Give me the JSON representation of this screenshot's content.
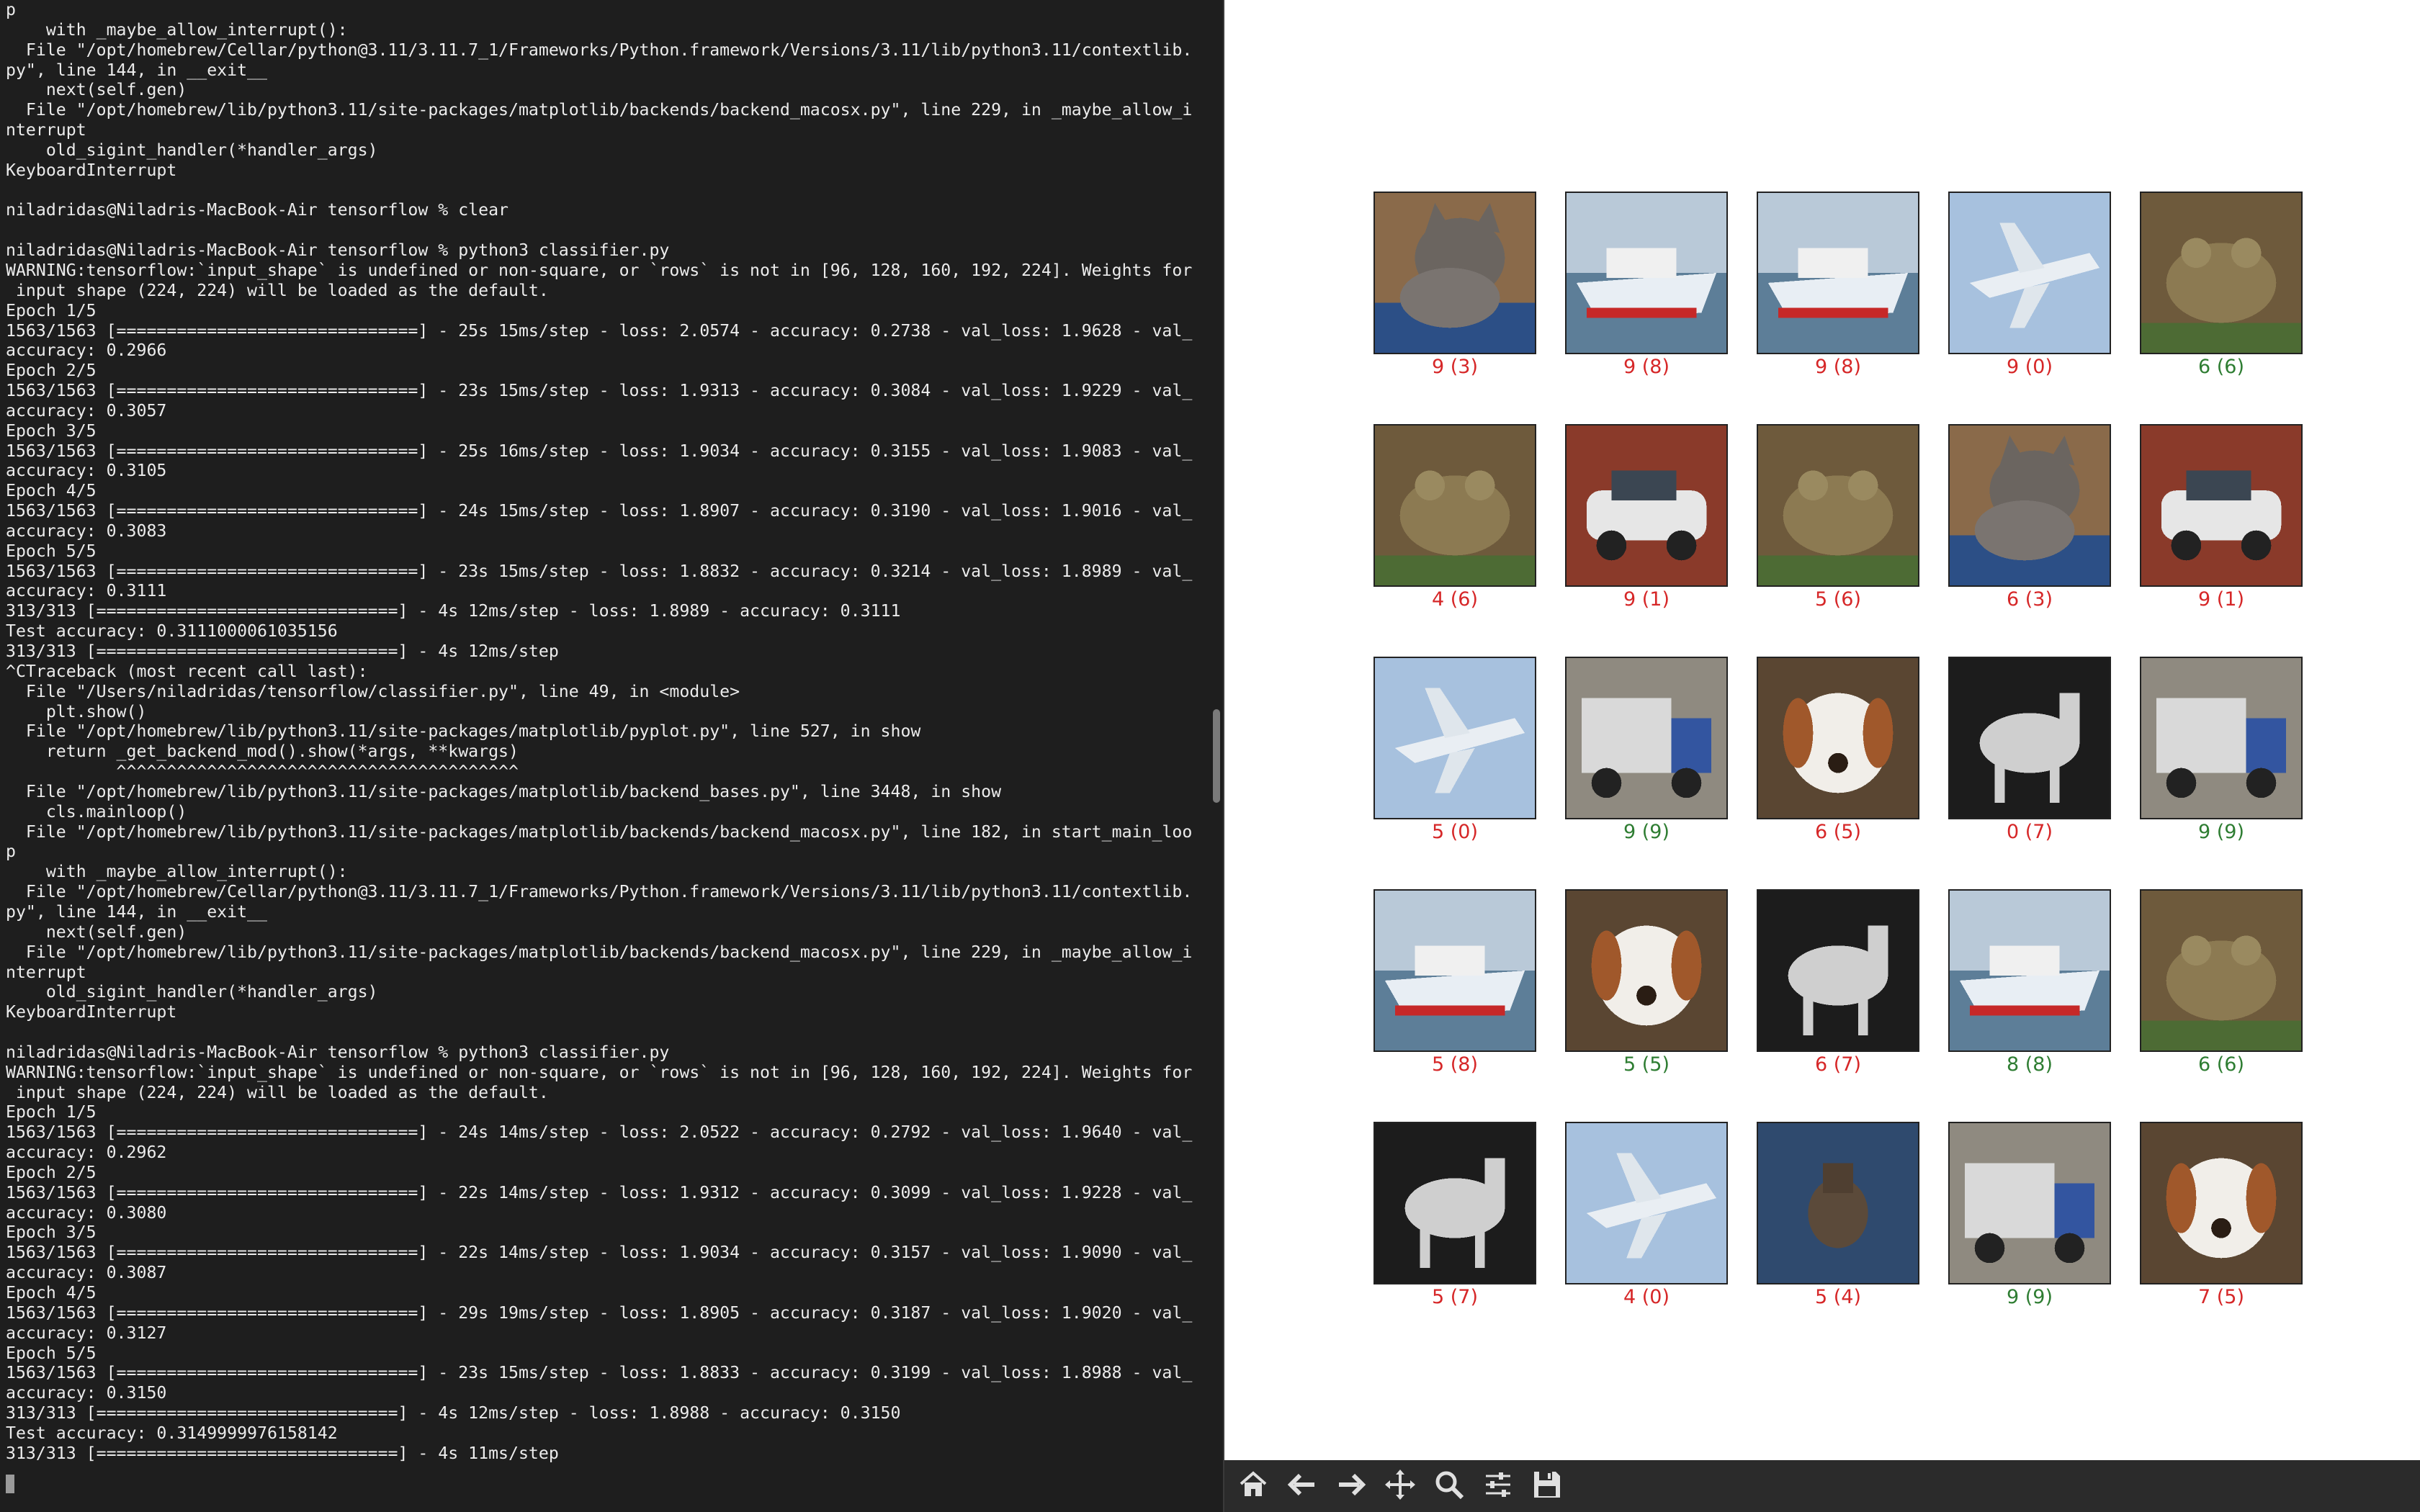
{
  "terminal": {
    "lines": [
      "p",
      "    with _maybe_allow_interrupt():",
      "  File \"/opt/homebrew/Cellar/python@3.11/3.11.7_1/Frameworks/Python.framework/Versions/3.11/lib/python3.11/contextlib.",
      "py\", line 144, in __exit__",
      "    next(self.gen)",
      "  File \"/opt/homebrew/lib/python3.11/site-packages/matplotlib/backends/backend_macosx.py\", line 229, in _maybe_allow_i",
      "nterrupt",
      "    old_sigint_handler(*handler_args)",
      "KeyboardInterrupt",
      "",
      "niladridas@Niladris-MacBook-Air tensorflow % clear",
      "",
      "niladridas@Niladris-MacBook-Air tensorflow % python3 classifier.py",
      "WARNING:tensorflow:`input_shape` is undefined or non-square, or `rows` is not in [96, 128, 160, 192, 224]. Weights for",
      " input shape (224, 224) will be loaded as the default.",
      "Epoch 1/5",
      "1563/1563 [==============================] - 25s 15ms/step - loss: 2.0574 - accuracy: 0.2738 - val_loss: 1.9628 - val_",
      "accuracy: 0.2966",
      "Epoch 2/5",
      "1563/1563 [==============================] - 23s 15ms/step - loss: 1.9313 - accuracy: 0.3084 - val_loss: 1.9229 - val_",
      "accuracy: 0.3057",
      "Epoch 3/5",
      "1563/1563 [==============================] - 25s 16ms/step - loss: 1.9034 - accuracy: 0.3155 - val_loss: 1.9083 - val_",
      "accuracy: 0.3105",
      "Epoch 4/5",
      "1563/1563 [==============================] - 24s 15ms/step - loss: 1.8907 - accuracy: 0.3190 - val_loss: 1.9016 - val_",
      "accuracy: 0.3083",
      "Epoch 5/5",
      "1563/1563 [==============================] - 23s 15ms/step - loss: 1.8832 - accuracy: 0.3214 - val_loss: 1.8989 - val_",
      "accuracy: 0.3111",
      "313/313 [==============================] - 4s 12ms/step - loss: 1.8989 - accuracy: 0.3111",
      "Test accuracy: 0.3111000061035156",
      "313/313 [==============================] - 4s 12ms/step",
      "^CTraceback (most recent call last):",
      "  File \"/Users/niladridas/tensorflow/classifier.py\", line 49, in <module>",
      "    plt.show()",
      "  File \"/opt/homebrew/lib/python3.11/site-packages/matplotlib/pyplot.py\", line 527, in show",
      "    return _get_backend_mod().show(*args, **kwargs)",
      "           ^^^^^^^^^^^^^^^^^^^^^^^^^^^^^^^^^^^^^^^^",
      "  File \"/opt/homebrew/lib/python3.11/site-packages/matplotlib/backend_bases.py\", line 3448, in show",
      "    cls.mainloop()",
      "  File \"/opt/homebrew/lib/python3.11/site-packages/matplotlib/backends/backend_macosx.py\", line 182, in start_main_loo",
      "p",
      "    with _maybe_allow_interrupt():",
      "  File \"/opt/homebrew/Cellar/python@3.11/3.11.7_1/Frameworks/Python.framework/Versions/3.11/lib/python3.11/contextlib.",
      "py\", line 144, in __exit__",
      "    next(self.gen)",
      "  File \"/opt/homebrew/lib/python3.11/site-packages/matplotlib/backends/backend_macosx.py\", line 229, in _maybe_allow_i",
      "nterrupt",
      "    old_sigint_handler(*handler_args)",
      "KeyboardInterrupt",
      "",
      "niladridas@Niladris-MacBook-Air tensorflow % python3 classifier.py",
      "WARNING:tensorflow:`input_shape` is undefined or non-square, or `rows` is not in [96, 128, 160, 192, 224]. Weights for",
      " input shape (224, 224) will be loaded as the default.",
      "Epoch 1/5",
      "1563/1563 [==============================] - 24s 14ms/step - loss: 2.0522 - accuracy: 0.2792 - val_loss: 1.9640 - val_",
      "accuracy: 0.2962",
      "Epoch 2/5",
      "1563/1563 [==============================] - 22s 14ms/step - loss: 1.9312 - accuracy: 0.3099 - val_loss: 1.9228 - val_",
      "accuracy: 0.3080",
      "Epoch 3/5",
      "1563/1563 [==============================] - 22s 14ms/step - loss: 1.9034 - accuracy: 0.3157 - val_loss: 1.9090 - val_",
      "accuracy: 0.3087",
      "Epoch 4/5",
      "1563/1563 [==============================] - 29s 19ms/step - loss: 1.8905 - accuracy: 0.3187 - val_loss: 1.9020 - val_",
      "accuracy: 0.3127",
      "Epoch 5/5",
      "1563/1563 [==============================] - 23s 15ms/step - loss: 1.8833 - accuracy: 0.3199 - val_loss: 1.8988 - val_",
      "accuracy: 0.3150",
      "313/313 [==============================] - 4s 12ms/step - loss: 1.8988 - accuracy: 0.3150",
      "Test accuracy: 0.3149999976158142",
      "313/313 [==============================] - 4s 11ms/step"
    ]
  },
  "figure": {
    "colors": {
      "correct": "#2e7d32",
      "wrong": "#d62728"
    },
    "predictions": [
      {
        "label": "9 (3)",
        "pred": 9,
        "true": 3,
        "subject": "cat"
      },
      {
        "label": "9 (8)",
        "pred": 9,
        "true": 8,
        "subject": "ship"
      },
      {
        "label": "9 (8)",
        "pred": 9,
        "true": 8,
        "subject": "ship"
      },
      {
        "label": "9 (0)",
        "pred": 9,
        "true": 0,
        "subject": "airplane"
      },
      {
        "label": "6 (6)",
        "pred": 6,
        "true": 6,
        "subject": "frog"
      },
      {
        "label": "4 (6)",
        "pred": 4,
        "true": 6,
        "subject": "frog"
      },
      {
        "label": "9 (1)",
        "pred": 9,
        "true": 1,
        "subject": "automobile"
      },
      {
        "label": "5 (6)",
        "pred": 5,
        "true": 6,
        "subject": "frog"
      },
      {
        "label": "6 (3)",
        "pred": 6,
        "true": 3,
        "subject": "cat"
      },
      {
        "label": "9 (1)",
        "pred": 9,
        "true": 1,
        "subject": "automobile"
      },
      {
        "label": "5 (0)",
        "pred": 5,
        "true": 0,
        "subject": "airplane"
      },
      {
        "label": "9 (9)",
        "pred": 9,
        "true": 9,
        "subject": "truck"
      },
      {
        "label": "6 (5)",
        "pred": 6,
        "true": 5,
        "subject": "dog"
      },
      {
        "label": "0 (7)",
        "pred": 0,
        "true": 7,
        "subject": "horse"
      },
      {
        "label": "9 (9)",
        "pred": 9,
        "true": 9,
        "subject": "truck"
      },
      {
        "label": "5 (8)",
        "pred": 5,
        "true": 8,
        "subject": "ship"
      },
      {
        "label": "5 (5)",
        "pred": 5,
        "true": 5,
        "subject": "dog"
      },
      {
        "label": "6 (7)",
        "pred": 6,
        "true": 7,
        "subject": "horse"
      },
      {
        "label": "8 (8)",
        "pred": 8,
        "true": 8,
        "subject": "ship"
      },
      {
        "label": "6 (6)",
        "pred": 6,
        "true": 6,
        "subject": "frog"
      },
      {
        "label": "5 (7)",
        "pred": 5,
        "true": 7,
        "subject": "horse"
      },
      {
        "label": "4 (0)",
        "pred": 4,
        "true": 0,
        "subject": "airplane"
      },
      {
        "label": "5 (4)",
        "pred": 5,
        "true": 4,
        "subject": "deer"
      },
      {
        "label": "9 (9)",
        "pred": 9,
        "true": 9,
        "subject": "truck"
      },
      {
        "label": "7 (5)",
        "pred": 7,
        "true": 5,
        "subject": "dog"
      }
    ]
  },
  "toolbar": {
    "buttons": [
      {
        "name": "home-button",
        "icon": "home-icon"
      },
      {
        "name": "back-button",
        "icon": "arrow-left-icon"
      },
      {
        "name": "forward-button",
        "icon": "arrow-right-icon"
      },
      {
        "name": "pan-button",
        "icon": "move-icon"
      },
      {
        "name": "zoom-button",
        "icon": "magnifier-icon"
      },
      {
        "name": "configure-subplots-button",
        "icon": "sliders-icon"
      },
      {
        "name": "save-button",
        "icon": "floppy-disk-icon"
      }
    ]
  }
}
